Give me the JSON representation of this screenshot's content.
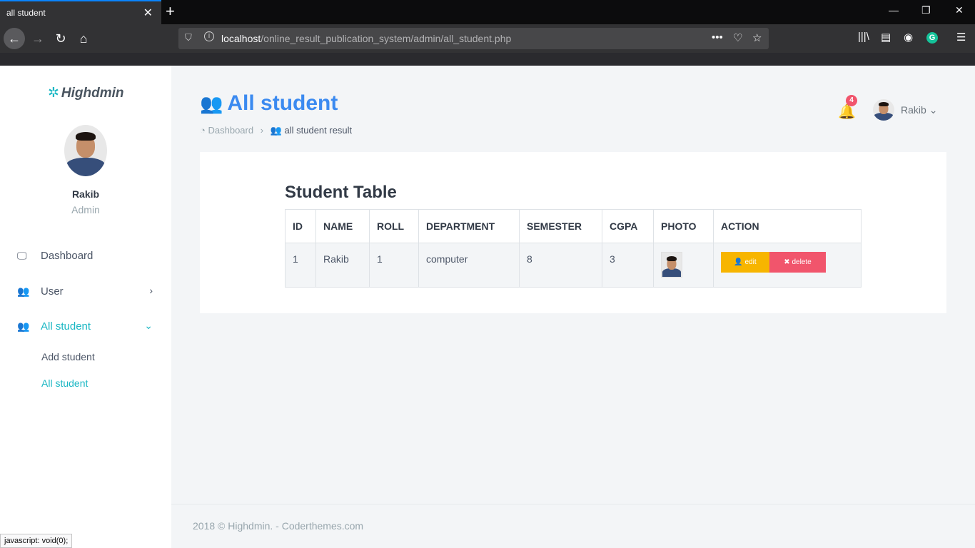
{
  "browser": {
    "tab_title": "all student",
    "tab_close": "✕",
    "new_tab": "+",
    "url_host": "localhost",
    "url_path": "/online_result_publication_system/admin/all_student.php",
    "url_actions": "•••",
    "status_text": "javascript: void(0);"
  },
  "sidebar": {
    "logo": "Highdmin",
    "user_name": "Rakib",
    "user_role": "Admin",
    "menu": [
      {
        "label": "Dashboard",
        "icon": "monitor-icon"
      },
      {
        "label": "User",
        "icon": "users-icon"
      },
      {
        "label": "All student",
        "icon": "users-icon"
      }
    ],
    "submenu": [
      {
        "label": "Add student"
      },
      {
        "label": "All student"
      }
    ]
  },
  "header": {
    "page_title": "All student",
    "breadcrumb_home": "Dashboard",
    "breadcrumb_sep": "›",
    "breadcrumb_current": "all student result",
    "notification_count": "4",
    "user_name": "Rakib"
  },
  "table": {
    "title": "Student Table",
    "columns": [
      "ID",
      "NAME",
      "ROLL",
      "DEPARTMENT",
      "SEMESTER",
      "CGPA",
      "PHOTO",
      "ACTION"
    ],
    "rows": [
      {
        "id": "1",
        "name": "Rakib",
        "roll": "1",
        "department": "computer",
        "semester": "8",
        "cgpa": "3"
      }
    ],
    "edit_label": "edit",
    "delete_label": "delete"
  },
  "footer": {
    "text": "2018 © Highdmin. - Coderthemes.com"
  },
  "colors": {
    "accent": "#1bb7c4",
    "title_blue": "#3b8af0",
    "edit": "#f7b500",
    "delete": "#f1556c"
  }
}
